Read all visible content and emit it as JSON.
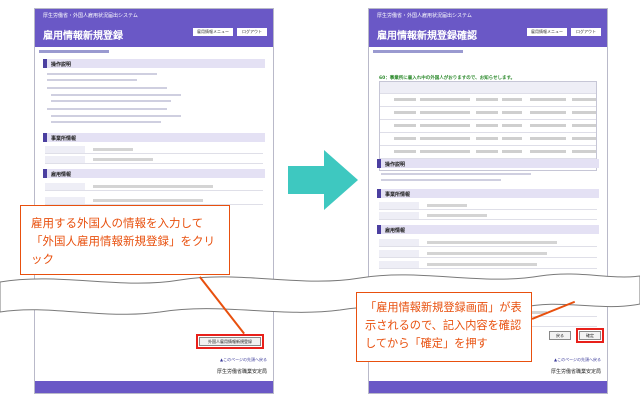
{
  "left_screen": {
    "system_title": "厚生労働省・外国人雇用状況届出システム",
    "page_title": "雇用情報新規登録",
    "menu_button": "雇用情報メニュー",
    "logout_button": "ログアウト",
    "register_button": "外国人雇用情報新規登録",
    "top_link": "▲このページの先頭へ戻る"
  },
  "right_screen": {
    "system_title": "厚生労働省・外国人雇用状況届出システム",
    "page_title": "雇用情報新規登録確認",
    "menu_button": "雇用情報メニュー",
    "logout_button": "ログアウト",
    "notice": "60：事業所に雇入れ中の外国人がおりますので、お知らせします。",
    "section_operation": "操作説明",
    "section_office": "事業所情報",
    "section_employment": "雇用情報",
    "back_button": "戻る",
    "confirm_button": "確定",
    "top_link": "▲このページの先頭へ戻る",
    "agency": "厚生労働省職業安定局"
  },
  "left_sections": {
    "operation": "操作説明",
    "office": "事業所情報",
    "employment": "雇用情報"
  },
  "left_agency": "厚生労働省職業安定局",
  "callout_left": "雇用する外国人の情報を入力して「外国人雇用情報新規登録」をクリック",
  "callout_right": "「雇用情報新規登録画面」が表示されるので、記入内容を確認してから「確定」を押す",
  "colors": {
    "accent": "#6a58c6",
    "callout": "#e8500e",
    "arrow": "#3ec8c0",
    "highlight": "#e8201a"
  }
}
